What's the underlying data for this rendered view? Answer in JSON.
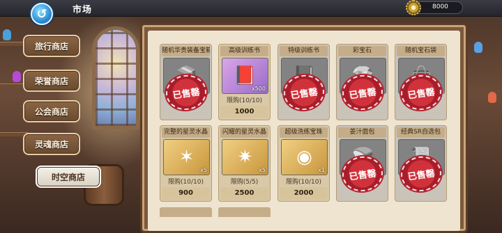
{
  "header": {
    "title": "市场",
    "currency_value": "8000",
    "back_icon": "back-arrow-icon",
    "currency_icon": "gear-coin-icon"
  },
  "sidebar": {
    "items": [
      {
        "label": "旅行商店"
      },
      {
        "label": "荣誉商店"
      },
      {
        "label": "公会商店"
      },
      {
        "label": "灵魂商店"
      },
      {
        "label": "时空商店",
        "active": true
      }
    ]
  },
  "shop": {
    "sold_label": "已售罄",
    "items": [
      {
        "name": "随机华贵装备宝箱",
        "icon": "treasure-chest-icon",
        "sold": true
      },
      {
        "name": "高级训练书",
        "icon": "purple-book-icon",
        "qty": "x500",
        "limit": "限购(10/10)",
        "price": "1000",
        "sold": false
      },
      {
        "name": "特级训练书",
        "icon": "book-icon",
        "sold": true
      },
      {
        "name": "彩宝石",
        "icon": "gem-icon",
        "sold": true
      },
      {
        "name": "随机宝石袋",
        "icon": "gem-bag-icon",
        "sold": true
      },
      {
        "name": "完整的星灵水晶",
        "icon": "green-crystal-icon",
        "qty": "x5",
        "limit": "限购(10/10)",
        "price": "900",
        "sold": false
      },
      {
        "name": "闪耀的星灵水晶",
        "icon": "blue-crystal-icon",
        "qty": "x5",
        "limit": "限购(5/5)",
        "price": "2500",
        "sold": false
      },
      {
        "name": "超级洗练宝珠",
        "icon": "orb-icon",
        "qty": "x1",
        "limit": "限购(10/10)",
        "price": "2000",
        "sold": false
      },
      {
        "name": "姜汁面包",
        "icon": "bread-icon",
        "sold": true
      },
      {
        "name": "经典SR自选包",
        "icon": "card-pack-icon",
        "sold": true
      }
    ]
  },
  "colors": {
    "accent_blue": "#2d8fd6",
    "stamp_red": "#d0323c",
    "panel_bg": "#efe4cf"
  }
}
